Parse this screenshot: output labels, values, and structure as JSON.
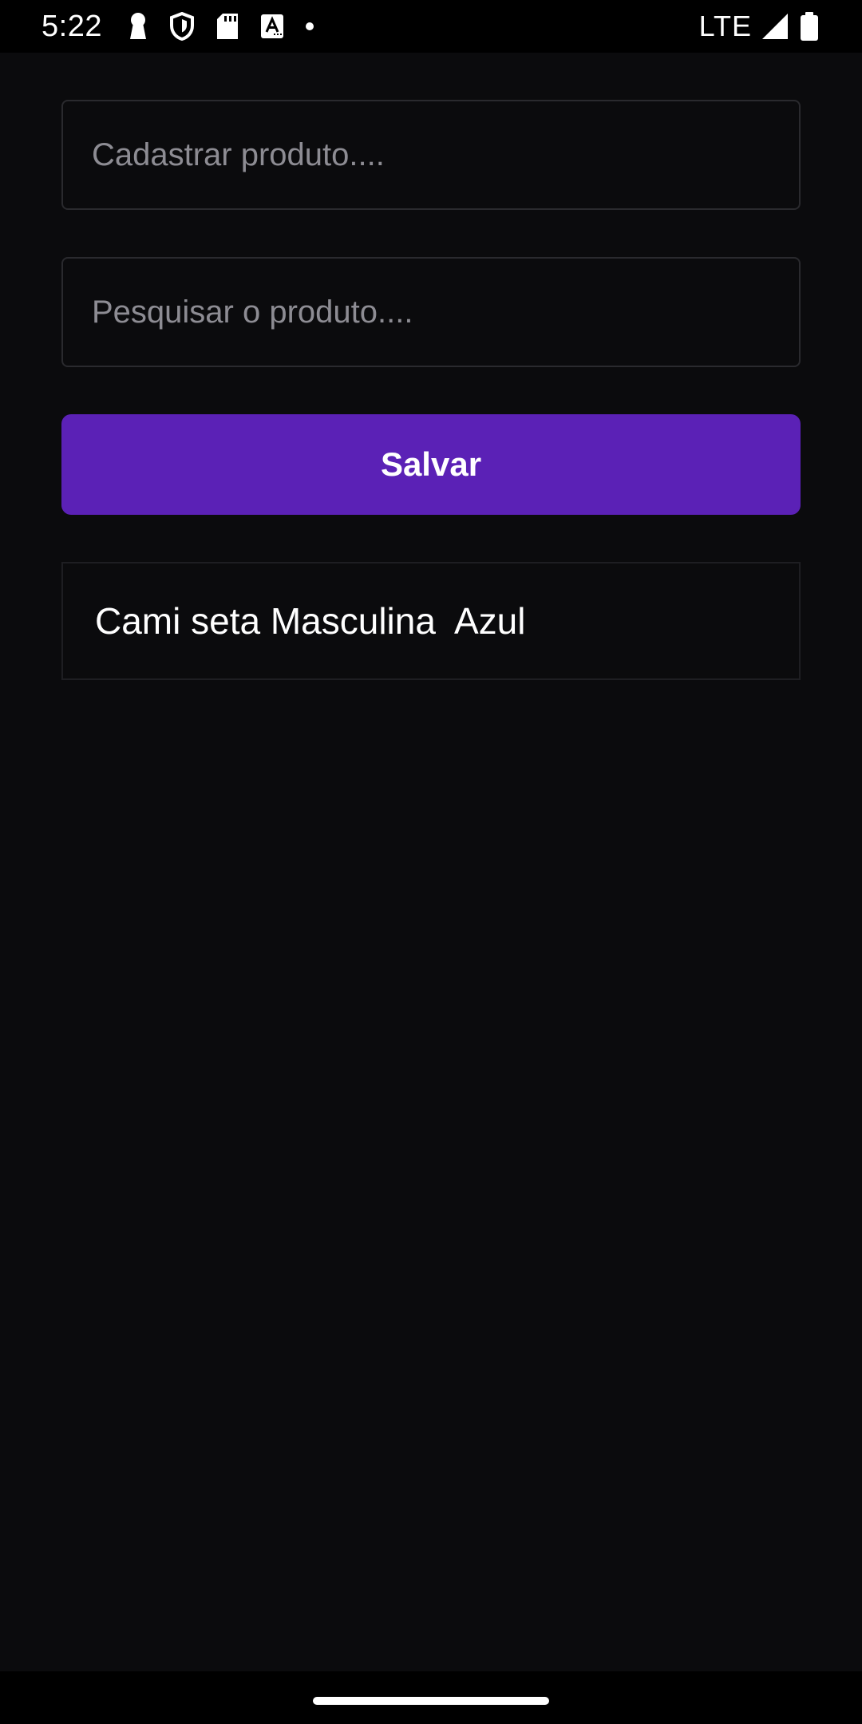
{
  "status_bar": {
    "time": "5:22",
    "network": "LTE",
    "left_icons": [
      "keyhole-icon",
      "shield-icon",
      "sd-card-icon",
      "font-icon",
      "dot-icon"
    ],
    "right_icons": [
      "signal-icon",
      "battery-icon"
    ]
  },
  "form": {
    "product_input": {
      "placeholder": "Cadastrar produto....",
      "value": ""
    },
    "search_input": {
      "placeholder": "Pesquisar o produto....",
      "value": ""
    },
    "save_label": "Salvar"
  },
  "products": [
    {
      "label": "Cami seta Masculina  Azul"
    }
  ],
  "colors": {
    "background": "#0b0b0d",
    "accent": "#5b21b6",
    "text": "#ffffff",
    "placeholder": "#8d8c93"
  }
}
